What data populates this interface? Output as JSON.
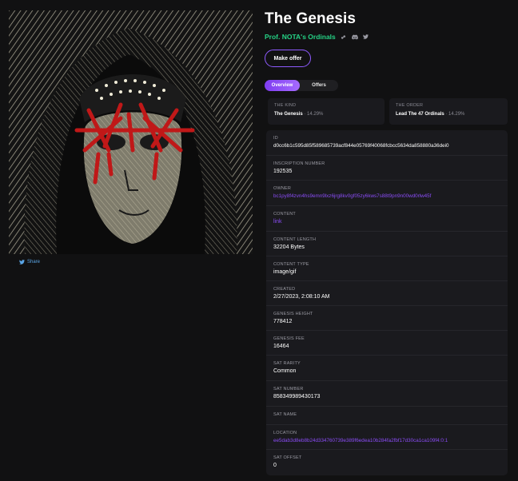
{
  "item": {
    "title": "The Genesis",
    "collection": "Prof. NOTA's Ordinals",
    "share_label": "Share",
    "make_offer_label": "Make offer"
  },
  "tabs": [
    "Overview",
    "Offers"
  ],
  "traits": [
    {
      "key": "THE KIND",
      "value": "The Genesis",
      "percent": " · 14.29%"
    },
    {
      "key": "THE ORDER",
      "value": "Lead The 47 Ordinals",
      "percent": " · 14.29%"
    }
  ],
  "details": [
    {
      "key": "ID",
      "value": "d0cc6b1c595d85f589685739acf844e05769f40068fcbcc5634da858880a36dei0",
      "link": false
    },
    {
      "key": "INSCRIPTION NUMBER",
      "value": "192535",
      "link": false
    },
    {
      "key": "OWNER",
      "value": "bc1py8f4zvn4hs9emn9lxz6jrg8kv0gf05zy6kws7s88t9pn9n00wd0rlw45f",
      "link": true
    },
    {
      "key": "CONTENT",
      "value": "link",
      "link": true
    },
    {
      "key": "CONTENT LENGTH",
      "value": "32204 Bytes",
      "link": false
    },
    {
      "key": "CONTENT TYPE",
      "value": "image/gif",
      "link": false
    },
    {
      "key": "CREATED",
      "value": "2/27/2023, 2:08:10 AM",
      "link": false
    },
    {
      "key": "GENESIS HEIGHT",
      "value": "778412",
      "link": false
    },
    {
      "key": "GENESIS FEE",
      "value": "16464",
      "link": false
    },
    {
      "key": "SAT RARITY",
      "value": "Common",
      "link": false
    },
    {
      "key": "SAT NUMBER",
      "value": "858349989430173",
      "link": false
    },
    {
      "key": "SAT NAME",
      "value": "",
      "link": false
    },
    {
      "key": "LOCATION",
      "value": "ee5dab3d8eb8b24d334760739e389f6edea10b284fa2fbf17d30ca1ca109f4:0:1",
      "link": true
    },
    {
      "key": "SAT OFFSET",
      "value": "0",
      "link": false
    }
  ],
  "colors": {
    "accent": "#8f5bff",
    "collection_green": "#25d285",
    "link_purple": "#8a4cf5",
    "share_blue": "#5aa5e6",
    "background": "#111112",
    "panel": "#1a1a1e"
  },
  "icons": {
    "share": "twitter-icon",
    "social": [
      "link-icon",
      "discord-icon",
      "twitter-icon"
    ]
  }
}
